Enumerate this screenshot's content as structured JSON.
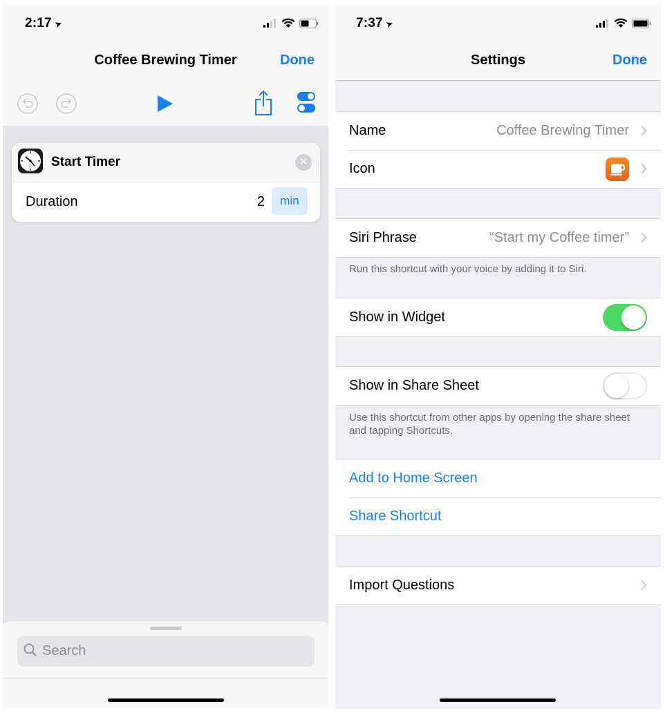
{
  "left": {
    "status": {
      "time": "2:17",
      "location_icon": "location-arrow-icon"
    },
    "nav": {
      "title": "Coffee Brewing Timer",
      "done": "Done"
    },
    "toolbar": {
      "undo_icon": "undo-icon",
      "redo_icon": "redo-icon",
      "play_icon": "play-icon",
      "share_icon": "share-icon",
      "settings_icon": "settings-toggle-icon"
    },
    "action": {
      "title": "Start Timer",
      "icon": "clock-icon",
      "param_label": "Duration",
      "param_value": "2",
      "param_unit": "min"
    },
    "search": {
      "placeholder": "Search"
    }
  },
  "right": {
    "status": {
      "time": "7:37"
    },
    "nav": {
      "title": "Settings",
      "done": "Done"
    },
    "rows": {
      "name_label": "Name",
      "name_value": "Coffee Brewing Timer",
      "icon_label": "Icon",
      "siri_label": "Siri Phrase",
      "siri_value": "“Start my Coffee timer”",
      "siri_footer": "Run this shortcut with your voice by adding it to Siri.",
      "widget_label": "Show in Widget",
      "widget_on": true,
      "share_sheet_label": "Show in Share Sheet",
      "share_sheet_on": false,
      "share_sheet_footer": "Use this shortcut from other apps by opening the share sheet and tapping Shortcuts.",
      "home_screen": "Add to Home Screen",
      "share_shortcut": "Share Shortcut",
      "import_questions": "Import Questions"
    }
  },
  "colors": {
    "accent": "#1a7ff0",
    "toggle_on": "#4cd964",
    "app_icon": "#e8641d"
  }
}
